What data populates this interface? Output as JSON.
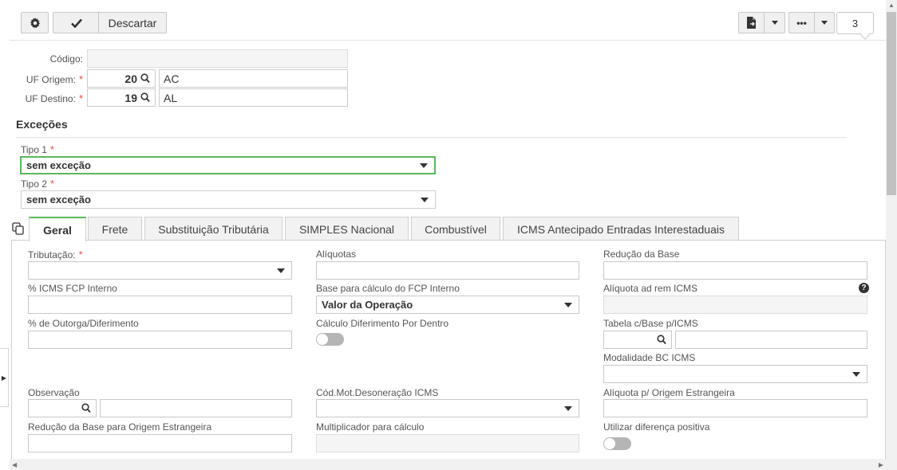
{
  "toolbar": {
    "discard_label": "Descartar",
    "counter_value": "3"
  },
  "header": {
    "codigo_label": "Código:",
    "codigo_value": "",
    "uf_origem_label": "UF Origem:",
    "uf_origem_code": "20",
    "uf_origem_name": "AC",
    "uf_destino_label": "UF Destino:",
    "uf_destino_code": "19",
    "uf_destino_name": "AL",
    "required_mark": "*"
  },
  "excecoes": {
    "title": "Exceções",
    "tipo1_label": "Tipo 1",
    "tipo1_value": "sem exceção",
    "tipo2_label": "Tipo 2",
    "tipo2_value": "sem exceção"
  },
  "tabs": [
    {
      "label": "Geral",
      "active": true
    },
    {
      "label": "Frete",
      "active": false
    },
    {
      "label": "Substituição Tributária",
      "active": false
    },
    {
      "label": "SIMPLES Nacional",
      "active": false
    },
    {
      "label": "Combustível",
      "active": false
    },
    {
      "label": "ICMS Antecipado Entradas Interestaduais",
      "active": false
    }
  ],
  "geral": {
    "tributacao_label": "Tributação:",
    "aliquotas_label": "Alíquotas",
    "reducao_base_label": "Redução da Base",
    "icms_fcp_label": "% ICMS FCP Interno",
    "base_fcp_label": "Base para cálculo do FCP Interno",
    "base_fcp_value": "Valor da Operação",
    "aliquota_ad_rem_label": "Alíquota ad rem ICMS",
    "outorga_label": "% de Outorga/Diferimento",
    "calculo_diferimento_label": "Cálculo Diferimento Por Dentro",
    "tabela_base_label": "Tabela c/Base p/ICMS",
    "modalidade_label": "Modalidade BC ICMS",
    "observacao_label": "Observação",
    "cod_mot_label": "Cód.Mot.Desoneração ICMS",
    "aliquota_estrangeira_label": "Alíquota p/ Origem Estrangeira",
    "reducao_estrangeira_label": "Redução da Base para Origem Estrangeira",
    "multiplicador_label": "Multiplicador para cálculo",
    "diferenca_positiva_label": "Utilizar diferença positiva",
    "help_glyph": "?"
  },
  "colors": {
    "accent_green": "#5cb85c",
    "required_red": "#d9534f"
  }
}
